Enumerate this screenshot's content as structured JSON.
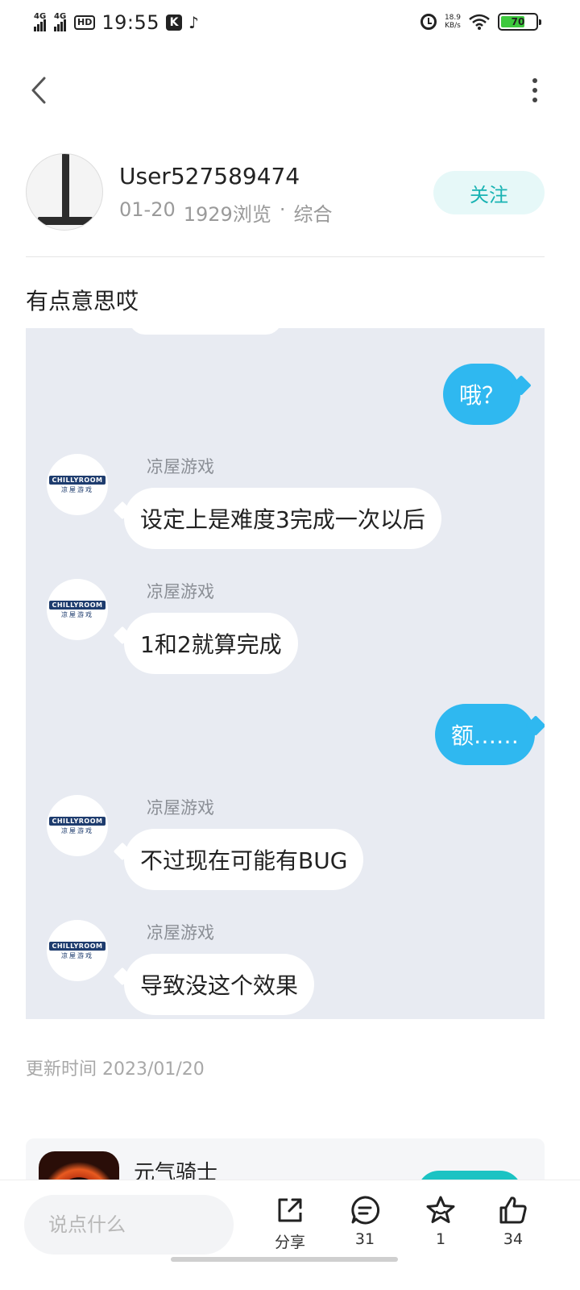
{
  "status_bar": {
    "network1": "4G",
    "network2": "4G",
    "hd": "HD",
    "time": "19:55",
    "speed_value": "18.9",
    "speed_unit": "KB/s",
    "battery": "70"
  },
  "author": {
    "name": "User527589474",
    "date": "01-20",
    "views": "1929浏览",
    "separator": "·",
    "category": "综合",
    "follow_label": "关注"
  },
  "post": {
    "title": "有点意思哎",
    "update_time": "更新时间 2023/01/20"
  },
  "chat": {
    "messages": [
      {
        "side": "right",
        "text": "哦？"
      },
      {
        "side": "left",
        "sender": "凉屋游戏",
        "text": "设定上是难度3完成一次以后"
      },
      {
        "side": "left",
        "sender": "凉屋游戏",
        "text": "1和2就算完成"
      },
      {
        "side": "right",
        "text": "额……"
      },
      {
        "side": "left",
        "sender": "凉屋游戏",
        "text": "不过现在可能有BUG"
      },
      {
        "side": "left",
        "sender": "凉屋游戏",
        "text": "导致没这个效果"
      }
    ],
    "avatar_logo_top": "CHILLYROOM",
    "avatar_logo_bottom": "凉屋游戏"
  },
  "game_card": {
    "name": "元气骑士"
  },
  "bottom_bar": {
    "input_placeholder": "说点什么",
    "share_label": "分享",
    "comment_count": "31",
    "favorite_count": "1",
    "like_count": "34"
  },
  "colors": {
    "accent": "#19b3b3",
    "follow_bg": "#e6f8f8",
    "chat_bg": "#e8ebf2",
    "my_bubble": "#2fb8f0"
  }
}
